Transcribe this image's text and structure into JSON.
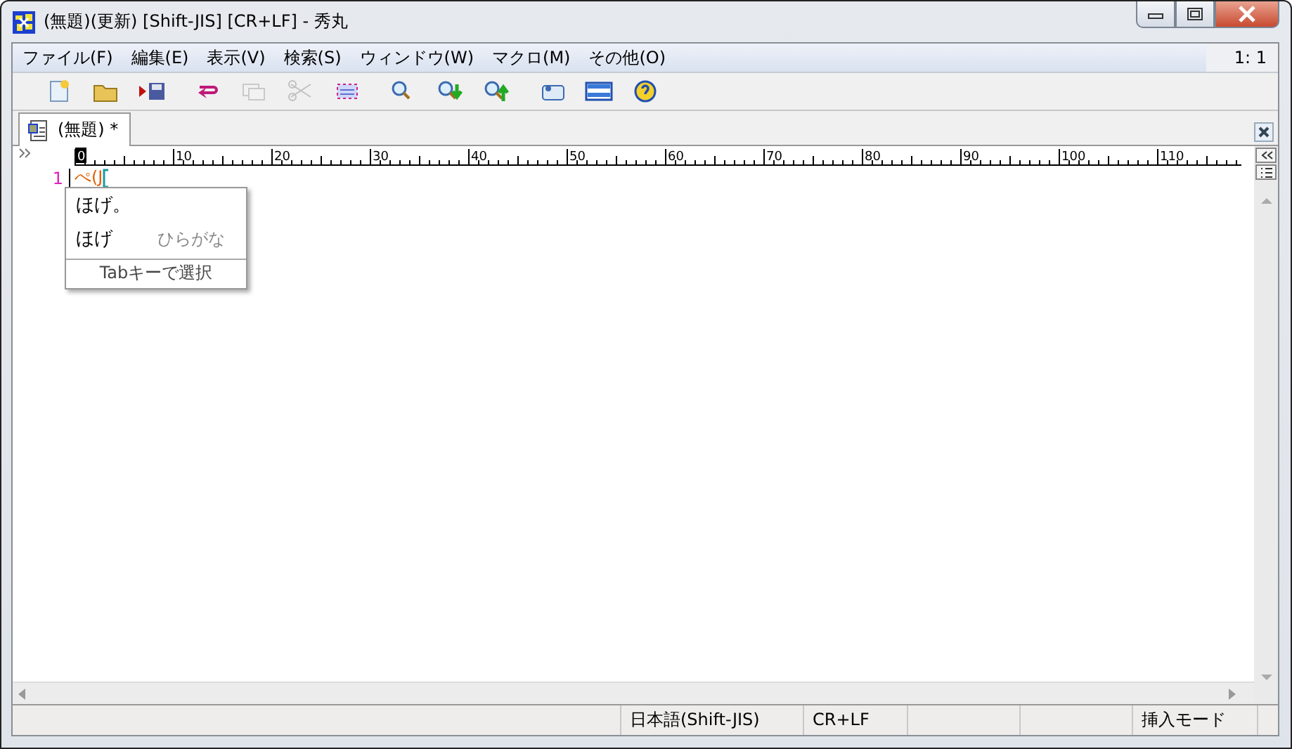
{
  "window": {
    "title": "(無題)(更新) [Shift-JIS] [CR+LF] - 秀丸"
  },
  "menu": {
    "items": [
      "ファイル(F)",
      "編集(E)",
      "表示(V)",
      "検索(S)",
      "ウィンドウ(W)",
      "マクロ(M)",
      "その他(O)"
    ],
    "position": "1: 1"
  },
  "toolbar": [
    {
      "kind": "new",
      "disabled": false
    },
    {
      "kind": "open",
      "disabled": false
    },
    {
      "kind": "save",
      "disabled": false
    },
    {
      "kind": "undo",
      "disabled": false
    },
    {
      "kind": "copy",
      "disabled": true
    },
    {
      "kind": "cut",
      "disabled": true
    },
    {
      "kind": "select",
      "disabled": false
    },
    {
      "kind": "search",
      "disabled": false
    },
    {
      "kind": "search-down",
      "disabled": false
    },
    {
      "kind": "search-up",
      "disabled": false
    },
    {
      "kind": "tag",
      "disabled": false
    },
    {
      "kind": "split",
      "disabled": false
    },
    {
      "kind": "help",
      "disabled": false
    }
  ],
  "tabs": [
    {
      "label": "(無題) *",
      "selected": true
    }
  ],
  "ruler": {
    "marks": [
      {
        "label": "0",
        "selected": true
      },
      {
        "label": "10",
        "selected": false
      },
      {
        "label": "20",
        "selected": false
      },
      {
        "label": "30",
        "selected": false
      },
      {
        "label": "40",
        "selected": false
      },
      {
        "label": "50",
        "selected": false
      },
      {
        "label": "60",
        "selected": false
      },
      {
        "label": "70",
        "selected": false
      },
      {
        "label": "80",
        "selected": false
      },
      {
        "label": "90",
        "selected": false
      },
      {
        "label": "100",
        "selected": false
      },
      {
        "label": "110",
        "selected": false
      }
    ]
  },
  "lines": [
    {
      "number": "1",
      "text": "ぺ(J"
    }
  ],
  "ime_popup": {
    "candidates": [
      {
        "text": "ほげ。",
        "selected": false
      },
      {
        "text": "ほげ",
        "note": "ひらがな",
        "selected": false
      }
    ],
    "footer": "Tabキーで選択"
  },
  "status_bar": [
    "日本語(Shift-JIS)",
    "CR+LF",
    "挿入モード"
  ]
}
